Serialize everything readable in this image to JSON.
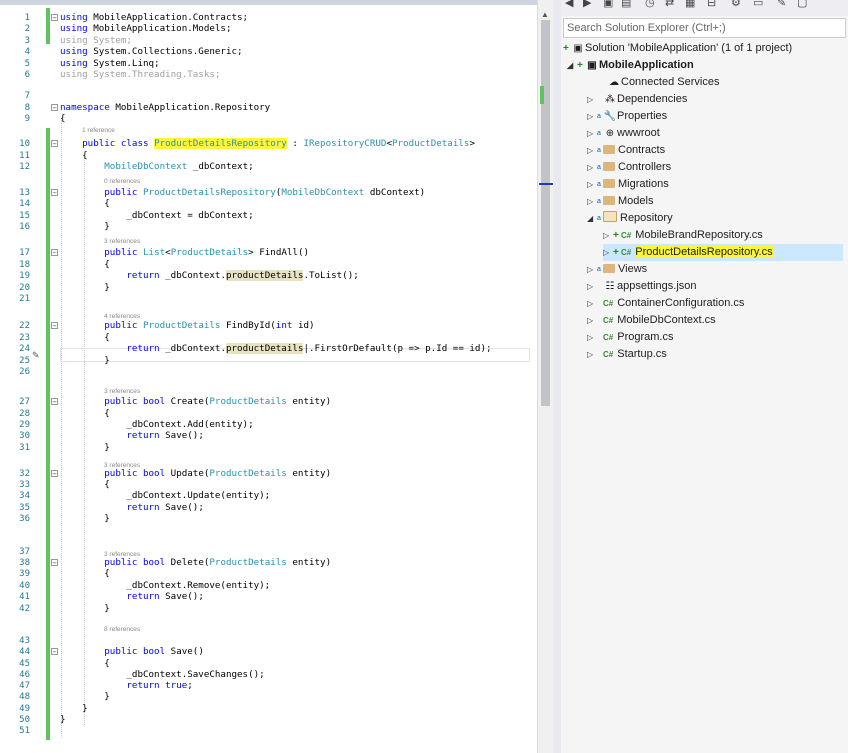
{
  "editor": {
    "lines": [
      {
        "n": "1",
        "c": "<span class='kw'>using</span> MobileApplication.Contracts;"
      },
      {
        "n": "2",
        "c": "<span class='kw'>using</span> MobileApplication.Models;"
      },
      {
        "n": "3",
        "c": "<span class='gr'>using System;</span>"
      },
      {
        "n": "4",
        "c": "<span class='kw'>using</span> System.Collections.Generic;"
      },
      {
        "n": "5",
        "c": "<span class='kw'>using</span> System.Linq;"
      },
      {
        "n": "6",
        "c": "<span class='gr'>using System.Threading.Tasks;</span>"
      },
      {
        "n": "7",
        "c": ""
      },
      {
        "n": "8",
        "c": "<span class='kw'>namespace</span> MobileApplication.Repository"
      },
      {
        "n": "9",
        "c": "{"
      },
      {
        "n": "10",
        "c": "    <span class='kw'>public class</span> <span class='ty hl'>ProductDetailsRepository</span> : <span class='ty'>IRepositoryCRUD</span>&lt;<span class='ty'>ProductDetails</span>&gt;"
      },
      {
        "n": "11",
        "c": "    {"
      },
      {
        "n": "12",
        "c": "        <span class='ty'>MobileDbContext</span> _dbContext;"
      },
      {
        "n": "13",
        "c": "        <span class='kw'>public</span> <span class='ty'>ProductDetailsRepository</span>(<span class='ty'>MobileDbContext</span> dbContext)"
      },
      {
        "n": "14",
        "c": "        {"
      },
      {
        "n": "15",
        "c": "            _dbContext = dbContext;"
      },
      {
        "n": "16",
        "c": "        }"
      },
      {
        "n": "17",
        "c": "        <span class='kw'>public</span> <span class='ty'>List</span>&lt;<span class='ty'>ProductDetails</span>&gt; FindAll()"
      },
      {
        "n": "18",
        "c": "        {"
      },
      {
        "n": "19",
        "c": "            <span class='kw'>return</span> _dbContext.<span class='fh'>productDetails</span>.ToList();"
      },
      {
        "n": "20",
        "c": "        }"
      },
      {
        "n": "21",
        "c": ""
      },
      {
        "n": "22",
        "c": "        <span class='kw'>public</span> <span class='ty'>ProductDetails</span> FindById(<span class='kw'>int</span> id)"
      },
      {
        "n": "23",
        "c": "        {"
      },
      {
        "n": "24",
        "c": "            <span class='kw'>return</span> _dbContext.<span class='fh'>productDetails</span>|.FirstOrDefault(p =&gt; p.Id == id);"
      },
      {
        "n": "25",
        "c": "        }"
      },
      {
        "n": "26",
        "c": ""
      },
      {
        "n": "27",
        "c": "        <span class='kw'>public bool</span> Create(<span class='ty'>ProductDetails</span> entity)"
      },
      {
        "n": "28",
        "c": "        {"
      },
      {
        "n": "29",
        "c": "            _dbContext.Add(entity);"
      },
      {
        "n": "30",
        "c": "            <span class='kw'>return</span> Save();"
      },
      {
        "n": "31",
        "c": "        }"
      },
      {
        "n": "32",
        "c": "        <span class='kw'>public bool</span> Update(<span class='ty'>ProductDetails</span> entity)"
      },
      {
        "n": "33",
        "c": "        {"
      },
      {
        "n": "34",
        "c": "            _dbContext.Update(entity);"
      },
      {
        "n": "35",
        "c": "            <span class='kw'>return</span> Save();"
      },
      {
        "n": "36",
        "c": "        }"
      },
      {
        "n": "37",
        "c": ""
      },
      {
        "n": "38",
        "c": "        <span class='kw'>public bool</span> Delete(<span class='ty'>ProductDetails</span> entity)"
      },
      {
        "n": "39",
        "c": "        {"
      },
      {
        "n": "40",
        "c": "            _dbContext.Remove(entity);"
      },
      {
        "n": "41",
        "c": "            <span class='kw'>return</span> Save();"
      },
      {
        "n": "42",
        "c": "        }"
      },
      {
        "n": "43",
        "c": ""
      },
      {
        "n": "44",
        "c": "        <span class='kw'>public bool</span> Save()"
      },
      {
        "n": "45",
        "c": "        {"
      },
      {
        "n": "46",
        "c": "            _dbContext.SaveChanges();"
      },
      {
        "n": "47",
        "c": "            <span class='kw'>return true</span>;"
      },
      {
        "n": "48",
        "c": "        }"
      },
      {
        "n": "49",
        "c": "    }"
      },
      {
        "n": "50",
        "c": "}"
      },
      {
        "n": "51",
        "c": ""
      }
    ],
    "refs": {
      "r10": "1 reference",
      "r13": "0 references",
      "r17": "3 references",
      "r22": "4 references",
      "r27": "3 references",
      "r32": "3 references",
      "r38": "3 references",
      "r44": "8 references"
    }
  },
  "solution_explorer": {
    "search_placeholder": "Search Solution Explorer (Ctrl+;)",
    "solution": "Solution 'MobileApplication' (1 of 1 project)",
    "project": "MobileApplication",
    "items": {
      "connected": "Connected Services",
      "dependencies": "Dependencies",
      "properties": "Properties",
      "wwwroot": "wwwroot",
      "contracts": "Contracts",
      "controllers": "Controllers",
      "migrations": "Migrations",
      "models": "Models",
      "repository": "Repository",
      "mobilebrand": "MobileBrandRepository.cs",
      "productdetails": "ProductDetailsRepository.cs",
      "views": "Views",
      "appsettings": "appsettings.json",
      "containerconfig": "ContainerConfiguration.cs",
      "mobiledbcontext": "MobileDbContext.cs",
      "program": "Program.cs",
      "startup": "Startup.cs"
    },
    "cs_badge": "C#"
  }
}
